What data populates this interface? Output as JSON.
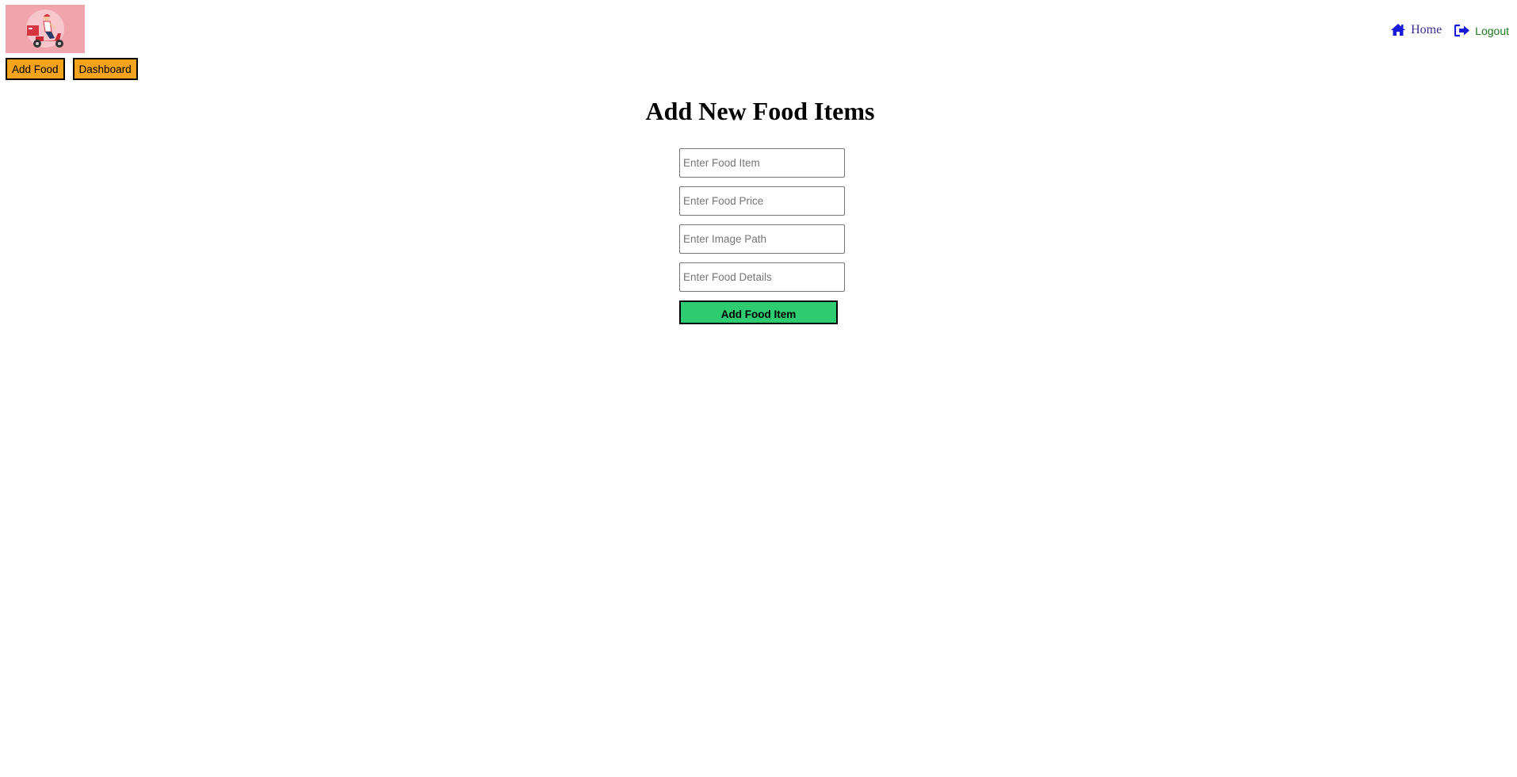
{
  "header": {
    "logo_icon": "delivery-scooter-icon",
    "nav": {
      "home_label": "Home",
      "home_icon": "home-icon",
      "logout_label": "Logout",
      "logout_icon": "sign-out-icon"
    }
  },
  "toolbar": {
    "add_food_label": "Add Food",
    "dashboard_label": "Dashboard"
  },
  "main": {
    "title": "Add New Food Items",
    "form": {
      "food_item": {
        "value": "",
        "placeholder": "Enter Food Item"
      },
      "food_price": {
        "value": "",
        "placeholder": "Enter Food Price"
      },
      "image_path": {
        "value": "",
        "placeholder": "Enter Image Path"
      },
      "food_details": {
        "value": "",
        "placeholder": "Enter Food Details"
      },
      "submit_label": "Add Food Item"
    }
  },
  "colors": {
    "logo_bg": "#f0a5ad",
    "nav_button_bg": "#f5a31a",
    "submit_bg": "#2ecc71",
    "home_link": "#3a2a8c",
    "logout_link": "#1a7a1a",
    "icon_blue": "#1a1adb"
  }
}
